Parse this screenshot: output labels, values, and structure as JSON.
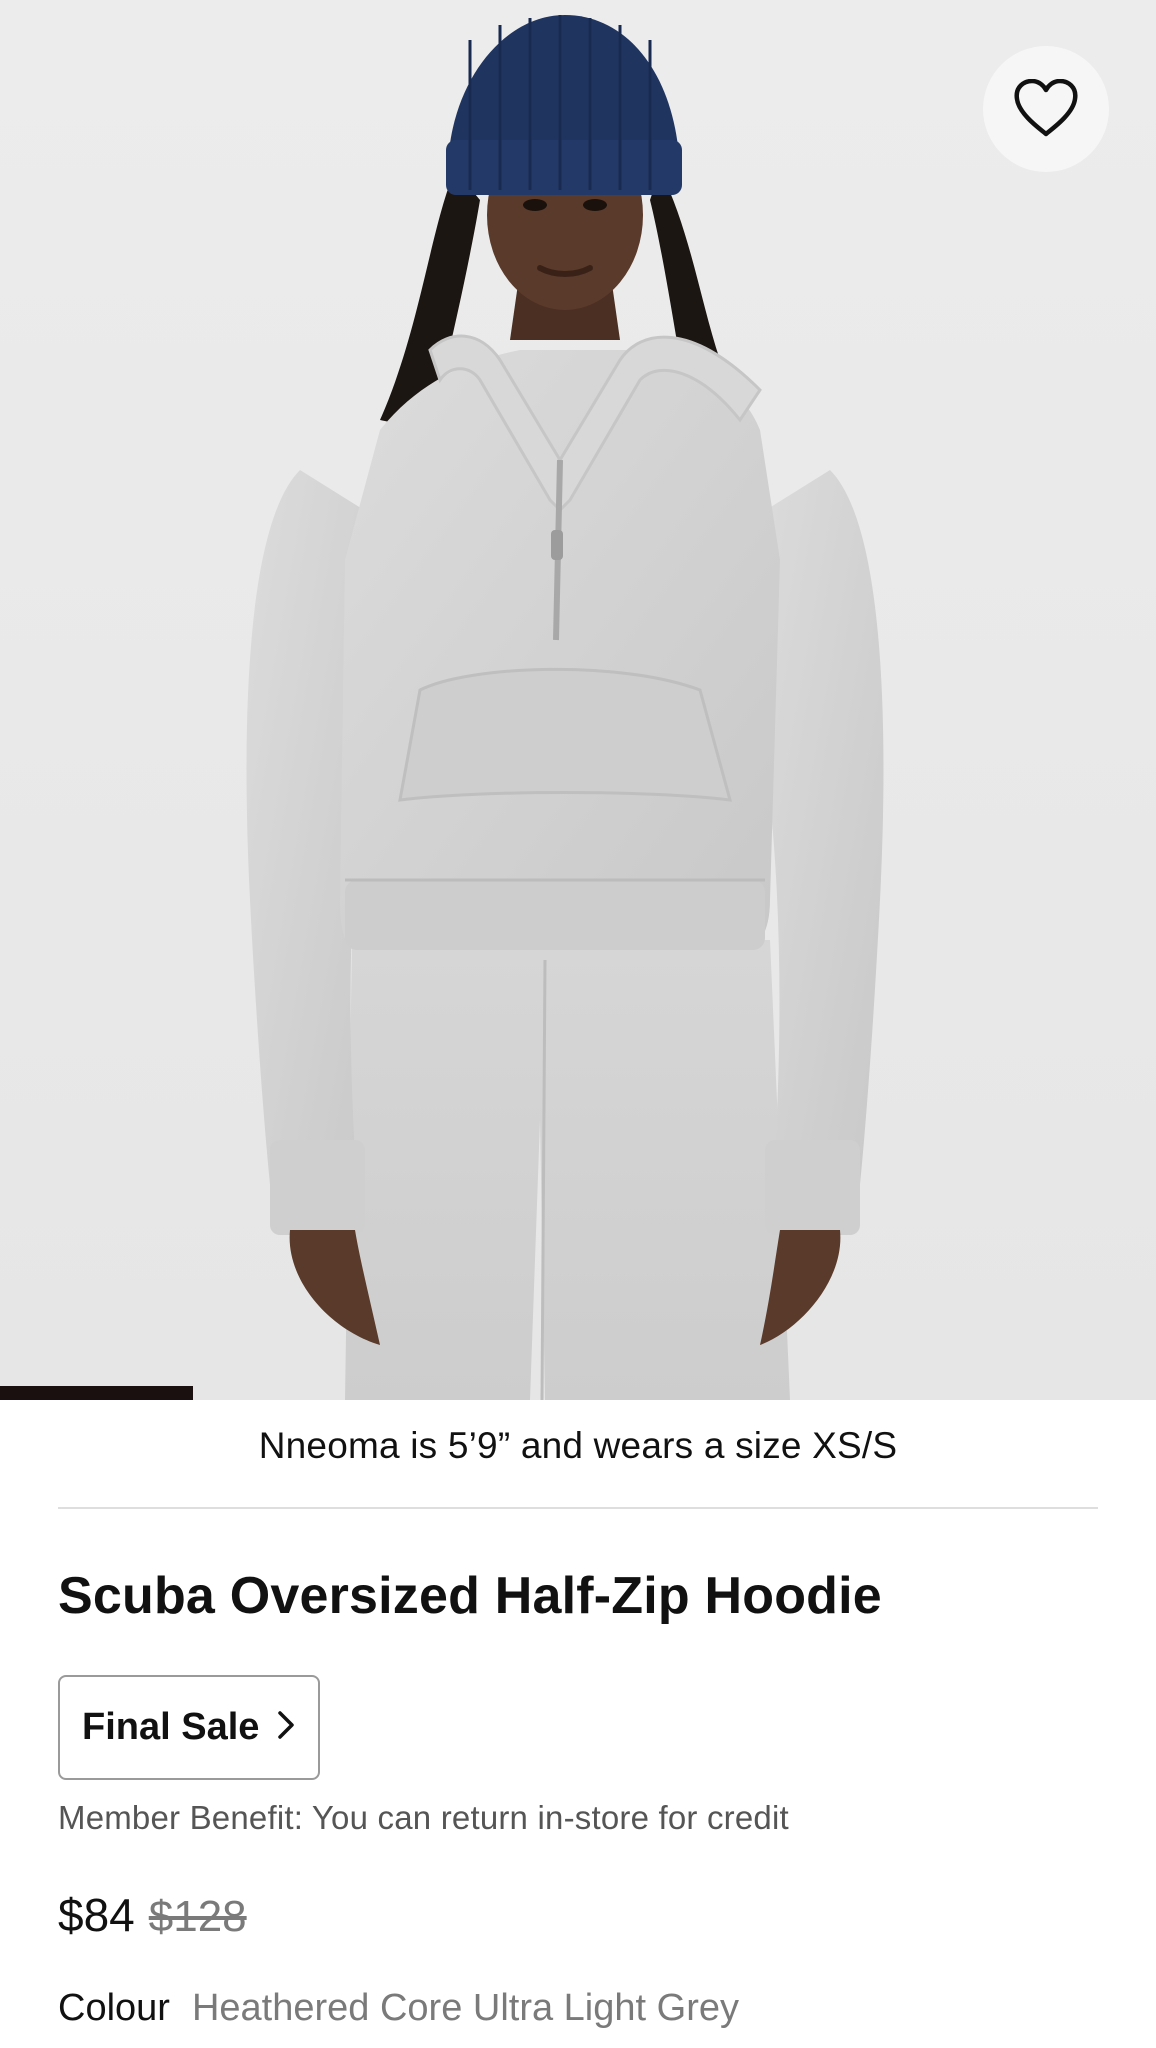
{
  "hero": {
    "image_subject": "Model wearing a heathered light grey half-zip hoodie, matching joggers and a navy knit beanie",
    "background_color": "#e9e9e9",
    "wishlist_icon": "heart-outline-icon",
    "carousel_progress": 0.167
  },
  "details": {
    "model_caption": "Nneoma is 5’9” and wears a size XS/S",
    "product_title": "Scuba Oversized Half-Zip Hoodie",
    "final_sale_label": "Final Sale",
    "final_sale_icon": "chevron-right-icon",
    "member_benefit": "Member Benefit: You can return in-store for credit",
    "price_current": "$84",
    "price_original": "$128",
    "colour_label": "Colour",
    "colour_value": "Heathered Core Ultra Light Grey"
  },
  "colors": {
    "text_primary": "#111111",
    "text_secondary": "#7a7a7a",
    "progress": "#1a1010",
    "divider": "#dedede"
  }
}
